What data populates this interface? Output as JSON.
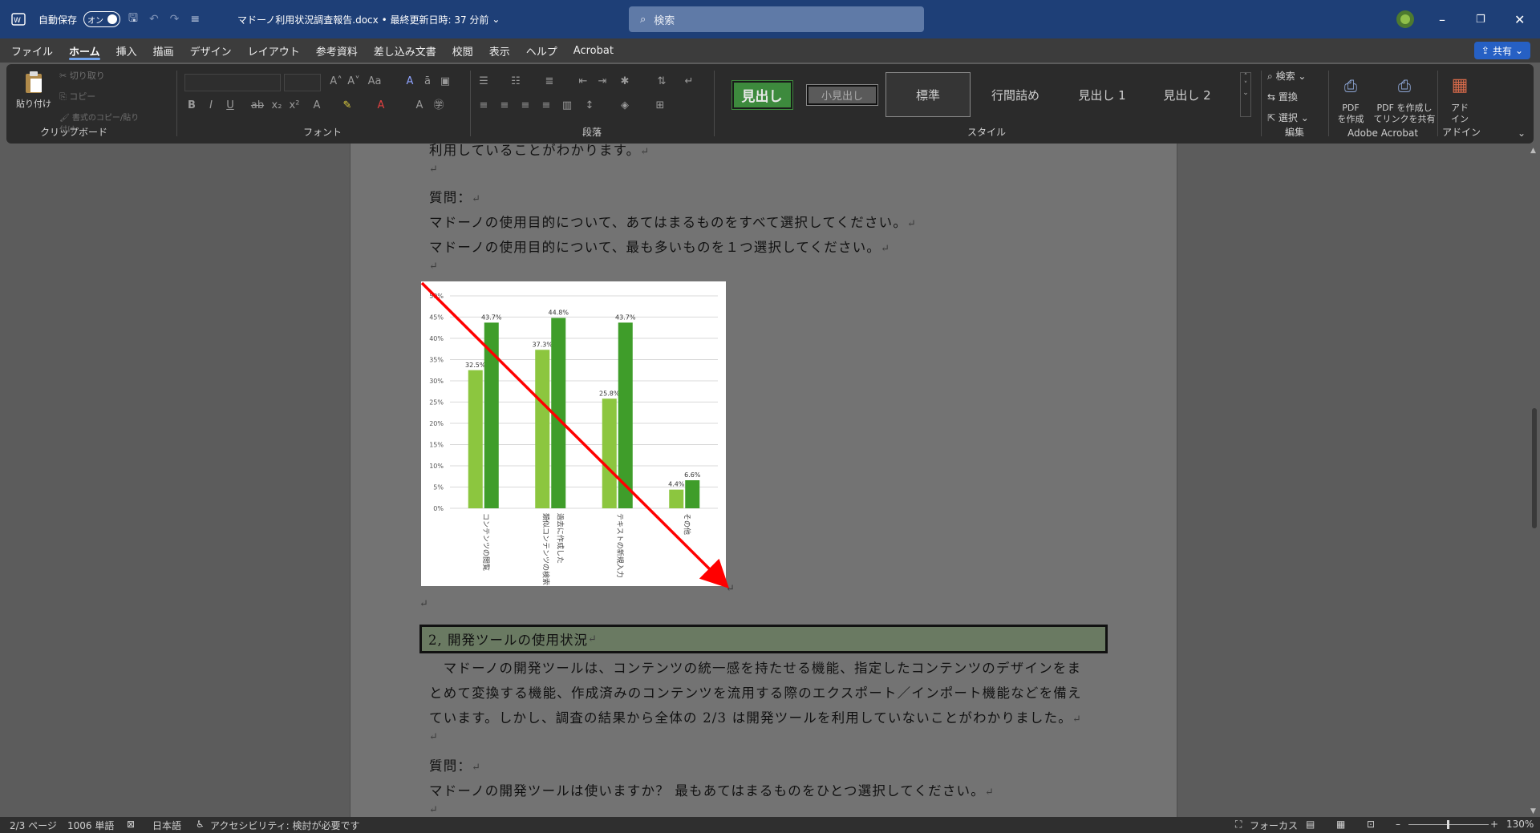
{
  "titlebar": {
    "autosave_label": "自動保存",
    "autosave_state": "オン",
    "document_title": "マドーノ利用状況調査報告.docx • 最終更新日時: 37 分前",
    "search_placeholder": "検索"
  },
  "tabs": [
    "ファイル",
    "ホーム",
    "挿入",
    "描画",
    "デザイン",
    "レイアウト",
    "参考資料",
    "差し込み文書",
    "校閲",
    "表示",
    "ヘルプ",
    "Acrobat"
  ],
  "share_label": "共有",
  "ribbon": {
    "clipboard": {
      "paste": "貼り付け",
      "cut": "切り取り",
      "copy": "コピー",
      "format_painter": "書式のコピー/貼り付け",
      "label": "クリップボード"
    },
    "font": {
      "label": "フォント"
    },
    "paragraph": {
      "label": "段落"
    },
    "styles": {
      "items": [
        "見出し",
        "小見出し",
        "標準",
        "行間詰め",
        "見出し 1",
        "見出し 2"
      ],
      "label": "スタイル"
    },
    "editing": {
      "find": "検索",
      "replace": "置換",
      "select": "選択",
      "label": "編集"
    },
    "acrobat": {
      "create_pdf": "PDF\nを作成",
      "share_pdf": "PDF を作成し\nてリンクを共有",
      "label": "Adobe Acrobat"
    },
    "addin": {
      "addin": "アド\nイン",
      "label": "アドイン"
    }
  },
  "document": {
    "line1": "利用していることがわかります。",
    "q_label": "質問：",
    "q_line1": "マドーノの使用目的について、あてはまるものをすべて選択してください。",
    "q_line2": "マドーノの使用目的について、最も多いものを１つ選択してください。",
    "heading2": "2,  開発ツールの使用状況",
    "body1": "　マドーノの開発ツールは、コンテンツの統一感を持たせる機能、指定したコンテンツのデザインをま",
    "body2": "とめて変換する機能、作成済みのコンテンツを流用する際のエクスポート／インポート機能などを備え",
    "body3": "ています。しかし、調査の結果から全体の 2/3 は開発ツールを利用していないことがわかりました。",
    "q2_label": "質問：",
    "q2_line": "マドーノの開発ツールは使いますか？ 最もあてはまるものをひとつ選択してください。",
    "para_mark": "↵"
  },
  "chart_data": {
    "type": "bar",
    "categories": [
      "コンテンツの閲覧",
      "類似コンテンツの検索",
      "過去に作成した",
      "テキストの新規入力",
      "その他"
    ],
    "groups": [
      {
        "labels": [
          "コンテンツの閲覧"
        ],
        "values": [
          32.5,
          43.7
        ]
      },
      {
        "labels": [
          "類似コンテンツの検索",
          "過去に作成した"
        ],
        "values": [
          37.3,
          44.8
        ]
      },
      {
        "labels": [
          "テキストの新規入力"
        ],
        "values": [
          25.8,
          43.7
        ]
      },
      {
        "labels": [
          "その他"
        ],
        "values": [
          4.4,
          6.6
        ]
      }
    ],
    "series_colors": [
      "#8cc63f",
      "#3f9d2a"
    ],
    "ylim": [
      0,
      50
    ],
    "yticks": [
      "0%",
      "5%",
      "10%",
      "15%",
      "20%",
      "25%",
      "30%",
      "35%",
      "40%",
      "45%",
      "50%"
    ],
    "annotation_color": "#ff0000"
  },
  "statusbar": {
    "page": "2/3 ページ",
    "words": "1006 単語",
    "language": "日本語",
    "accessibility": "アクセシビリティ: 検討が必要です",
    "focus": "フォーカス",
    "zoom": "130%"
  }
}
